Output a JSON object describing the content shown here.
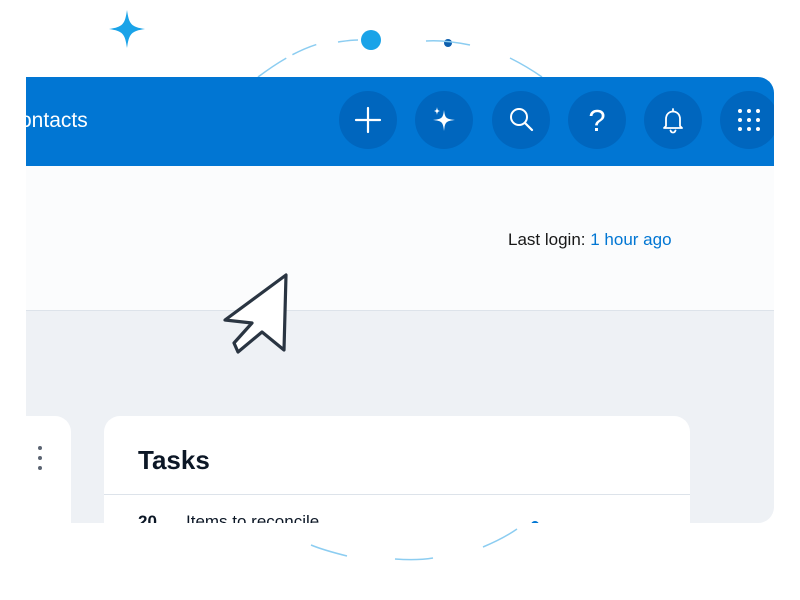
{
  "topbar": {
    "title": "ontacts",
    "buttons": [
      {
        "name": "new",
        "icon": "plus-icon"
      },
      {
        "name": "ai",
        "icon": "sparkle-icon"
      },
      {
        "name": "search",
        "icon": "search-icon"
      },
      {
        "name": "help",
        "icon": "help-icon",
        "glyph": "?"
      },
      {
        "name": "notifications",
        "icon": "bell-icon"
      },
      {
        "name": "app-launcher",
        "icon": "grid-icon"
      }
    ]
  },
  "header": {
    "last_login_label": "Last login:",
    "last_login_value": "1 hour ago"
  },
  "tasks": {
    "title": "Tasks",
    "items": [
      {
        "count": "20",
        "label": "Items to reconcile"
      }
    ]
  },
  "colors": {
    "brand_blue": "#0176d3",
    "panel_bg": "#eef1f5",
    "card_bg": "#ffffff",
    "text_dark": "#0c1726",
    "decor_blue": "#1aa3e8"
  }
}
